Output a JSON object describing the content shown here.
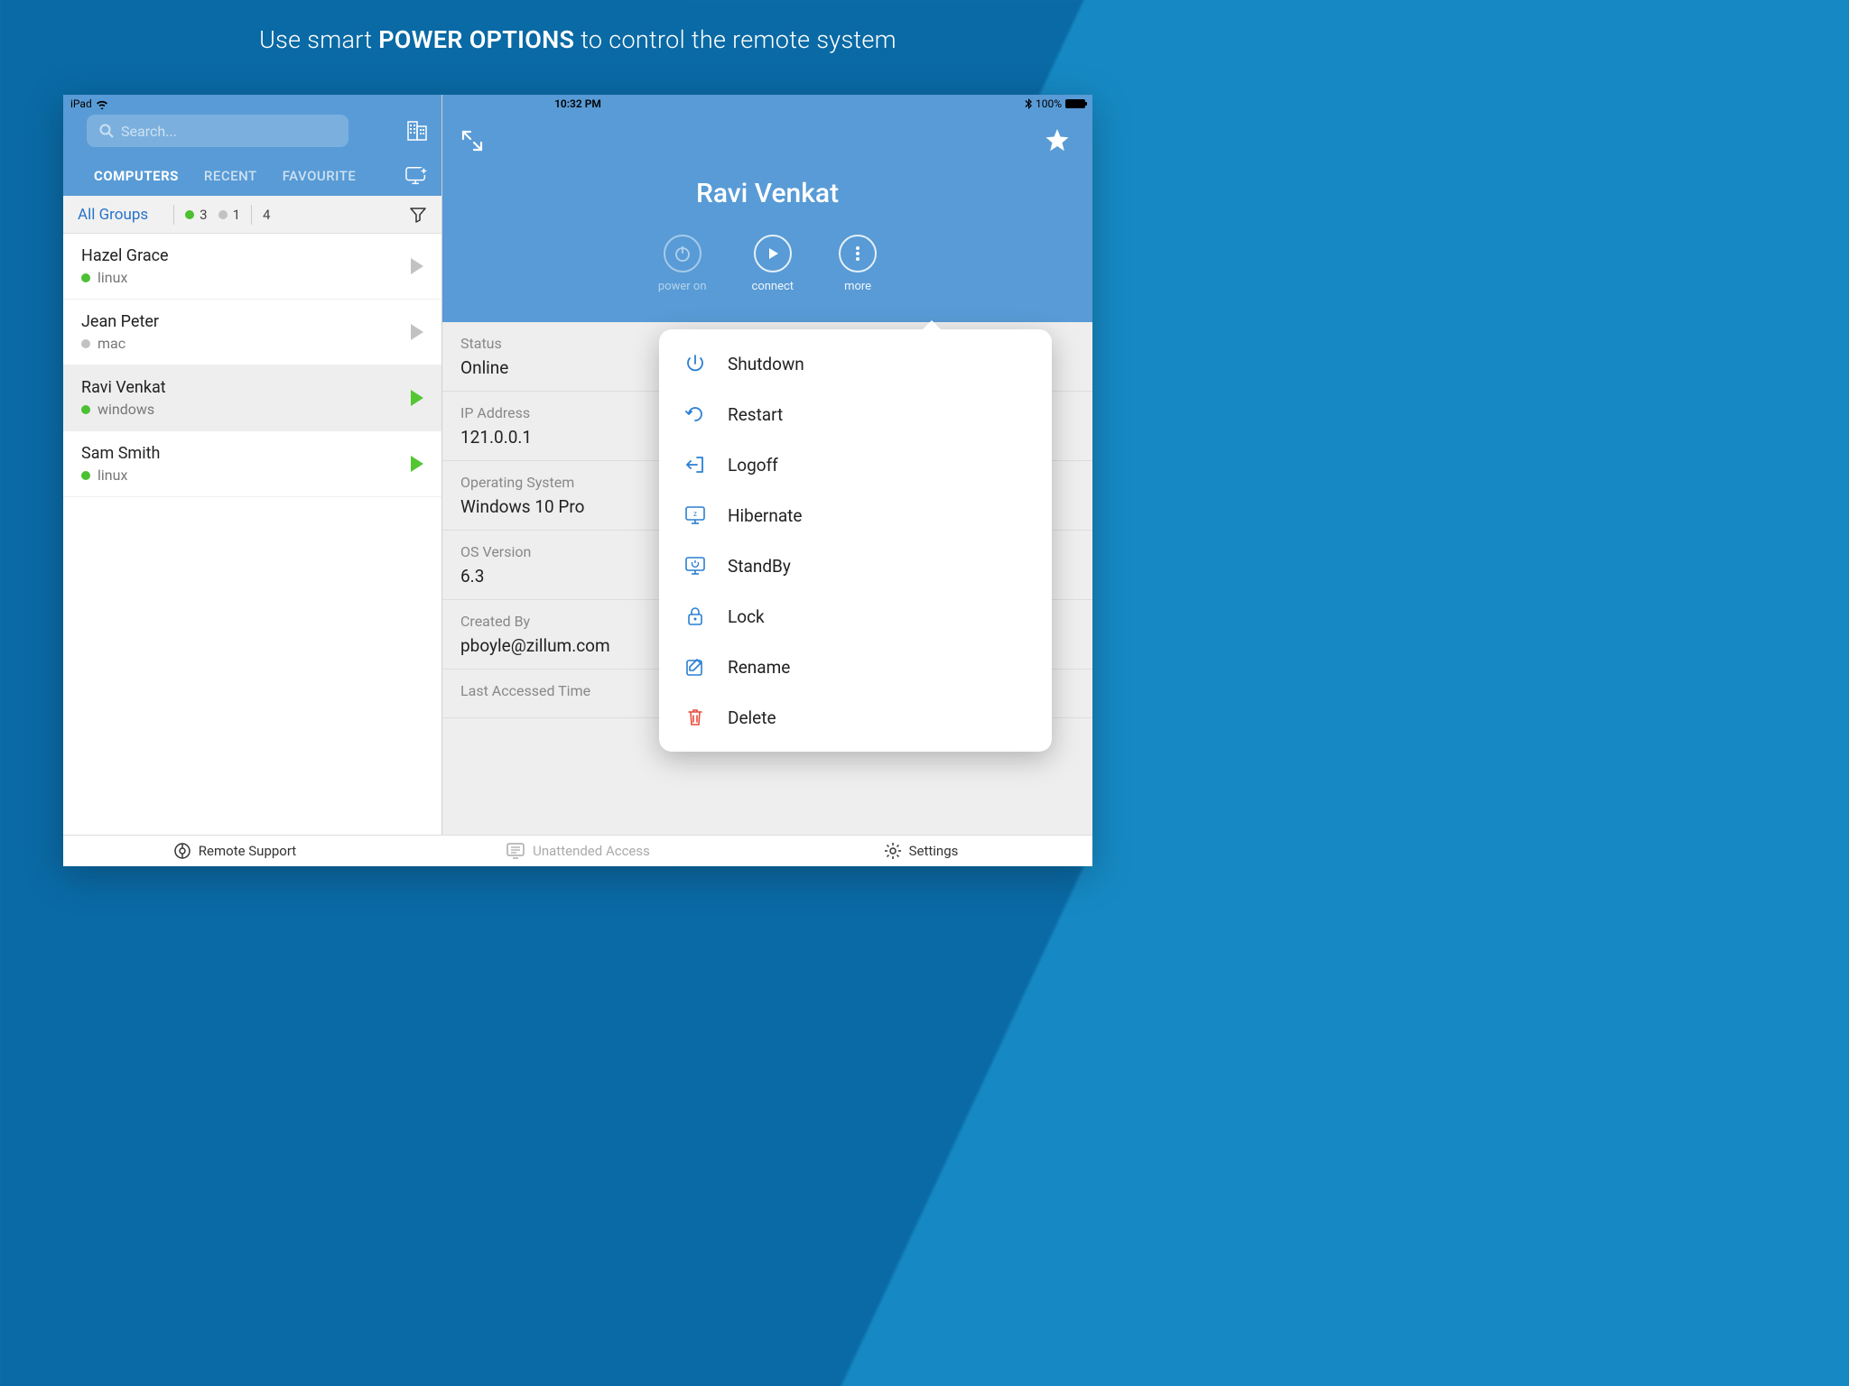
{
  "marketing": {
    "pre": "Use smart ",
    "bold": "POWER OPTIONS",
    "post": " to control the remote system"
  },
  "statusbar": {
    "device": "iPad",
    "time": "10:32 PM",
    "battery": "100%"
  },
  "search": {
    "placeholder": "Search..."
  },
  "tabs": {
    "computers": "COMPUTERS",
    "recent": "RECENT",
    "favourite": "FAVOURITE"
  },
  "filter": {
    "all_groups": "All Groups",
    "count_online": "3",
    "count_offline": "1",
    "count_total": "4"
  },
  "computers": [
    {
      "name": "Hazel Grace",
      "os": "linux",
      "online": true,
      "selected": false
    },
    {
      "name": "Jean Peter",
      "os": "mac",
      "online": false,
      "selected": false
    },
    {
      "name": "Ravi Venkat",
      "os": "windows",
      "online": true,
      "selected": true
    },
    {
      "name": "Sam Smith",
      "os": "linux",
      "online": true,
      "selected": false
    }
  ],
  "detail": {
    "title": "Ravi Venkat",
    "actions": {
      "power_on": "power on",
      "connect": "connect",
      "more": "more"
    },
    "rows": {
      "status_label": "Status",
      "status_value": "Online",
      "ip_label": "IP Address",
      "ip_value": "121.0.0.1",
      "os_label": "Operating System",
      "os_value": "Windows 10 Pro",
      "ver_label": "OS Version",
      "ver_value": "6.3",
      "created_label": "Created By",
      "created_value": "pboyle@zillum.com",
      "last_label": "Last Accessed Time"
    }
  },
  "popover": {
    "shutdown": "Shutdown",
    "restart": "Restart",
    "logoff": "Logoff",
    "hibernate": "Hibernate",
    "standby": "StandBy",
    "lock": "Lock",
    "rename": "Rename",
    "delete": "Delete"
  },
  "bottom": {
    "remote": "Remote Support",
    "unattended": "Unattended Access",
    "settings": "Settings"
  }
}
